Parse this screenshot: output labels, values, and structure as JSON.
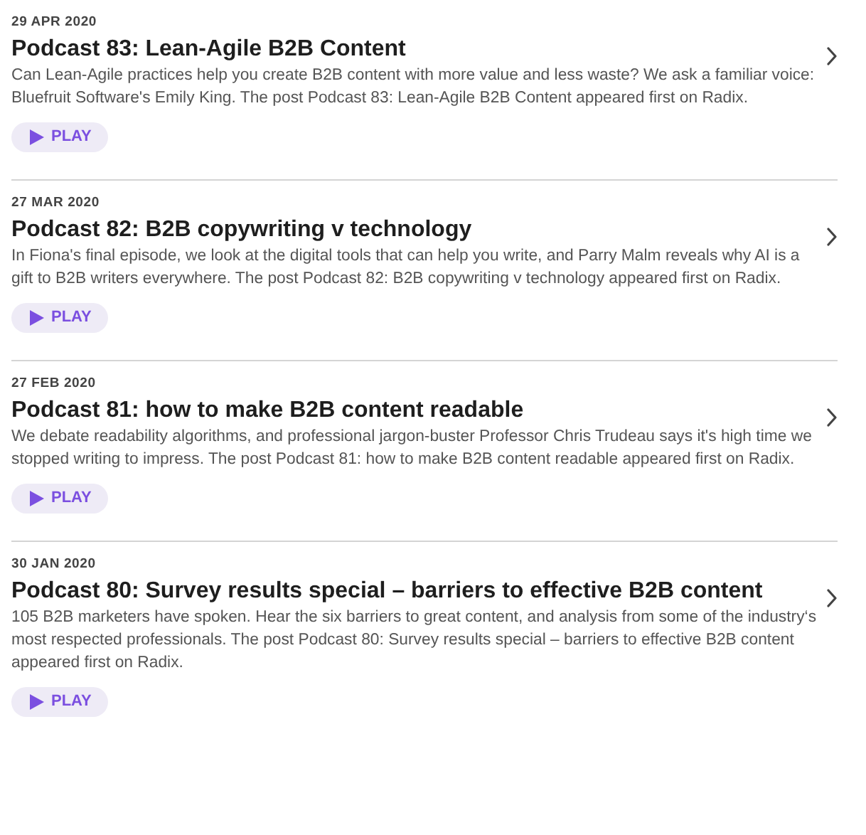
{
  "episodes": [
    {
      "date": "29 APR 2020",
      "title": "Podcast 83: Lean-Agile B2B Content",
      "description": "Can Lean-Agile practices help you create B2B content with more value and less waste? We ask a familiar voice: Bluefruit Software's Emily King. The post Podcast 83: Lean-Agile B2B Content appeared first on Radix.",
      "play_label": "PLAY"
    },
    {
      "date": "27 MAR 2020",
      "title": "Podcast 82: B2B copywriting v technology",
      "description": "In Fiona's final episode, we look at the digital tools that can help you write, and Parry Malm reveals why AI is a gift to B2B writers everywhere. The post Podcast 82: B2B copywriting v technology appeared first on Radix.",
      "play_label": "PLAY"
    },
    {
      "date": "27 FEB 2020",
      "title": "Podcast 81: how to make B2B content readable",
      "description": "We debate readability algorithms, and professional jargon-buster Professor Chris Trudeau says it's high time we stopped writing to impress. The post Podcast 81: how to make B2B content readable appeared first on Radix.",
      "play_label": "PLAY"
    },
    {
      "date": "30 JAN 2020",
      "title": "Podcast 80: Survey results special – barriers to effective B2B content",
      "description": "105 B2B marketers have spoken. Hear the six barriers to great content, and analysis from some of the industry‘s most respected professionals. The post Podcast 80: Survey results special – barriers to effective B2B content appeared first on Radix.",
      "play_label": "PLAY"
    }
  ]
}
